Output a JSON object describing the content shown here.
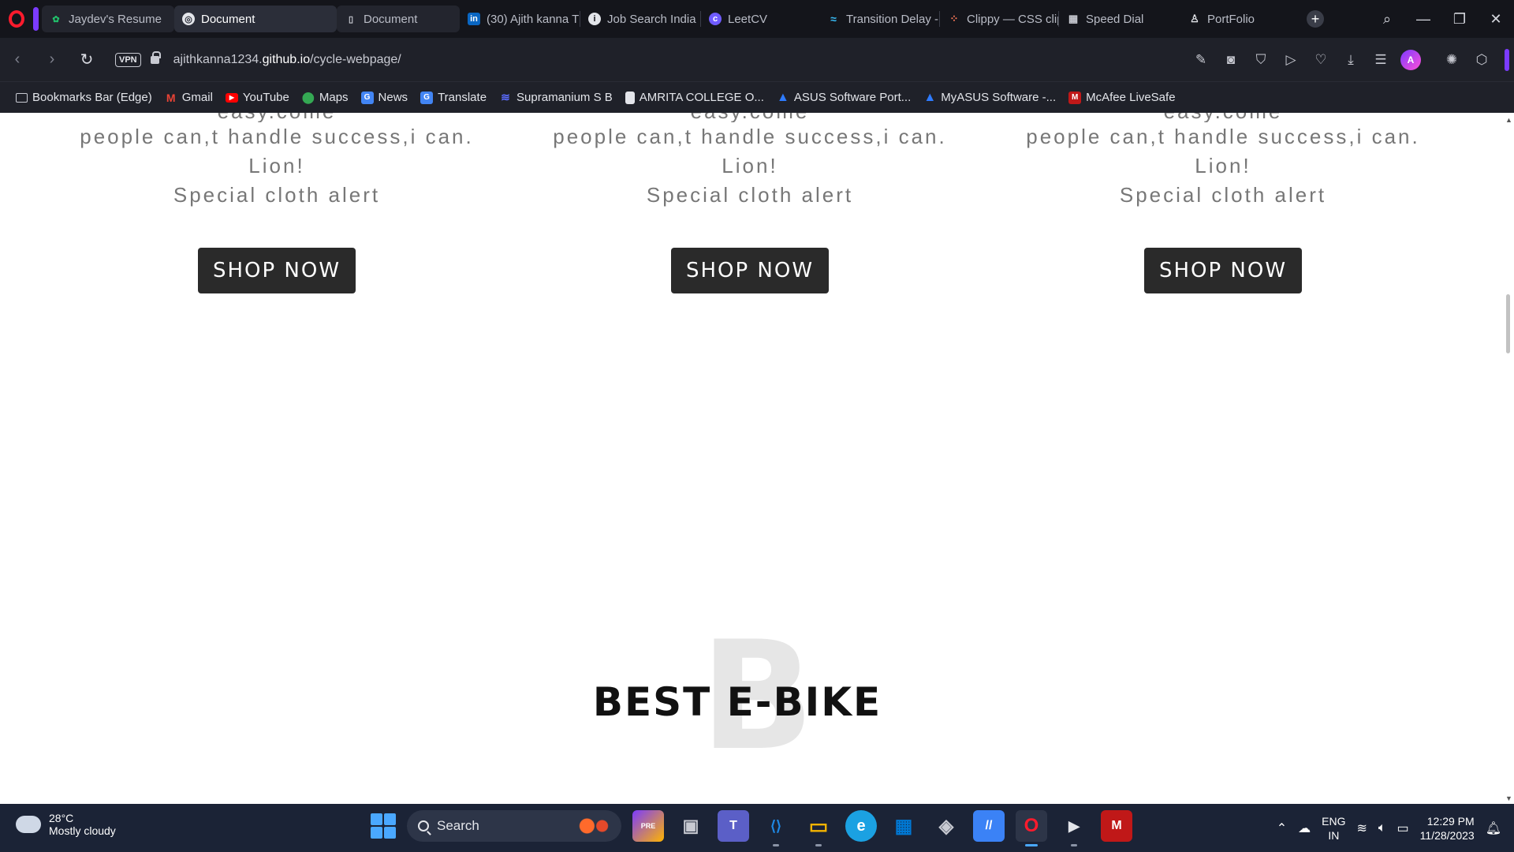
{
  "browser": {
    "tabs": [
      {
        "title": "Jaydev's Resume",
        "icon": "leaf-icon",
        "color": "#21c16b",
        "active": false
      },
      {
        "title": "Document",
        "icon": "globe-icon",
        "color": "#e3e5ea",
        "active": true
      },
      {
        "title": "Document",
        "icon": "file-icon",
        "color": "#c8cad2",
        "active": false
      },
      {
        "title": "(30) Ajith kanna T",
        "icon": "linkedin-icon",
        "color": "#0a66c2",
        "active": false
      },
      {
        "title": "Job Search India |",
        "icon": "info-icon",
        "color": "#e3e5ea",
        "active": false
      },
      {
        "title": "LeetCV",
        "icon": "leetcv-icon",
        "color": "#6f5bff",
        "active": false
      },
      {
        "title": "Transition Delay -",
        "icon": "tailwind-icon",
        "color": "#38bdf8",
        "active": false
      },
      {
        "title": "Clippy — CSS clip",
        "icon": "clippy-icon",
        "color": "#ff7a59",
        "active": false
      },
      {
        "title": "Speed Dial",
        "icon": "grid-icon",
        "color": "#c8cad2",
        "active": false
      },
      {
        "title": "PortFolio",
        "icon": "person-icon",
        "color": "#e3e5ea",
        "active": false
      }
    ],
    "new_tab": "+",
    "address": {
      "vpn": "VPN",
      "url_prefix": "ajithkanna1234.",
      "url_domain": "github.io",
      "url_path": "/cycle-webpage/"
    },
    "bookmarks": [
      {
        "label": "Bookmarks Bar (Edge)",
        "icon": "folder-icon",
        "color": "#c8cad2"
      },
      {
        "label": "Gmail",
        "icon": "gmail-icon",
        "color": "#ea4335"
      },
      {
        "label": "YouTube",
        "icon": "youtube-icon",
        "color": "#ff0000"
      },
      {
        "label": "Maps",
        "icon": "maps-pin-icon",
        "color": "#34a853"
      },
      {
        "label": "News",
        "icon": "news-icon",
        "color": "#4285f4"
      },
      {
        "label": "Translate",
        "icon": "translate-icon",
        "color": "#4285f4"
      },
      {
        "label": "Supramanium S B",
        "icon": "wave-icon",
        "color": "#5b6cff"
      },
      {
        "label": "AMRITA COLLEGE O...",
        "icon": "file-icon",
        "color": "#e3e5ea"
      },
      {
        "label": "ASUS Software Port...",
        "icon": "asus-icon",
        "color": "#2e7bff"
      },
      {
        "label": "MyASUS Software -...",
        "icon": "asus-icon",
        "color": "#2e7bff"
      },
      {
        "label": "McAfee LiveSafe",
        "icon": "mcafee-icon",
        "color": "#c01818"
      }
    ]
  },
  "page": {
    "products": [
      {
        "clipped": "easy.come",
        "line1": "people can,t handle success,i can.",
        "line2": "Lion!",
        "line3": "Special cloth alert",
        "button": "SHOP NOW"
      },
      {
        "clipped": "easy.come",
        "line1": "people can,t handle success,i can.",
        "line2": "Lion!",
        "line3": "Special cloth alert",
        "button": "SHOP NOW"
      },
      {
        "clipped": "easy.come",
        "line1": "people can,t handle success,i can.",
        "line2": "Lion!",
        "line3": "Special cloth alert",
        "button": "SHOP NOW"
      }
    ],
    "section_bg_letter": "B",
    "section_title": "BEST E-BIKE"
  },
  "taskbar": {
    "weather": {
      "temp": "28°C",
      "desc": "Mostly cloudy"
    },
    "search_label": "Search",
    "apps": [
      {
        "name": "copilot-icon",
        "label": "PRE",
        "color": "#7b3bff"
      },
      {
        "name": "task-view-icon",
        "label": "▣",
        "color": "#8a93a6"
      },
      {
        "name": "teams-icon",
        "label": "T",
        "color": "#5b5fc7"
      },
      {
        "name": "vscode-icon",
        "label": "⟨⟩",
        "color": "#1e88e5"
      },
      {
        "name": "file-explorer-icon",
        "label": "▭",
        "color": "#f4b400"
      },
      {
        "name": "edge-icon",
        "label": "e",
        "color": "#1ba1e2"
      },
      {
        "name": "ms-store-icon",
        "label": "▦",
        "color": "#0078d4"
      },
      {
        "name": "unity-icon",
        "label": "◈",
        "color": "#6b7280"
      },
      {
        "name": "visual-studio-icon",
        "label": "//",
        "color": "#3b82f6"
      },
      {
        "name": "opera-icon",
        "label": "O",
        "color": "#ff1b2d"
      },
      {
        "name": "media-player-icon",
        "label": "▶",
        "color": "#374151"
      },
      {
        "name": "mcafee-icon",
        "label": "M",
        "color": "#c01818"
      }
    ],
    "tray": {
      "lang_top": "ENG",
      "lang_bottom": "IN",
      "time": "12:29 PM",
      "date": "11/28/2023"
    }
  }
}
